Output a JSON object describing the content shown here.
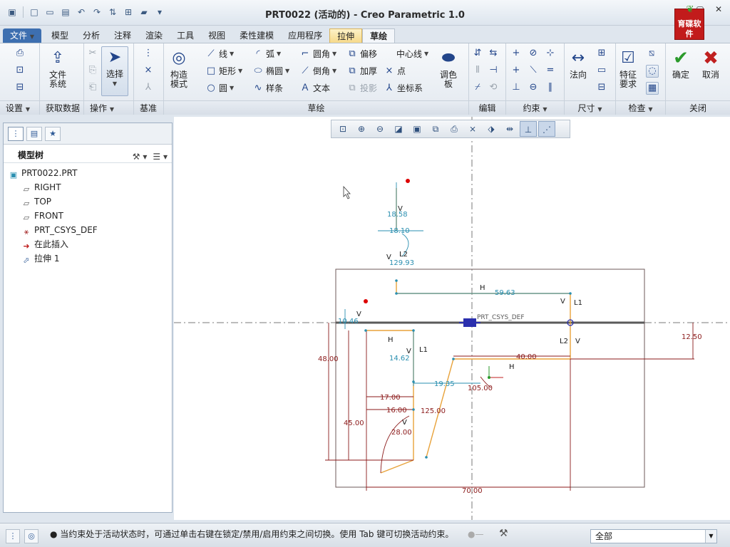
{
  "window": {
    "title": "PRT0022 (活动的) - Creo Parametric 1.0",
    "logo_text": "育碟软件"
  },
  "tabs": [
    {
      "label": "文件"
    },
    {
      "label": "模型"
    },
    {
      "label": "分析"
    },
    {
      "label": "注释"
    },
    {
      "label": "渲染"
    },
    {
      "label": "工具"
    },
    {
      "label": "视图"
    },
    {
      "label": "柔性建模"
    },
    {
      "label": "应用程序"
    },
    {
      "label": "拉伸"
    },
    {
      "label": "草绘"
    }
  ],
  "ribbon": {
    "groups": {
      "settings": "设置",
      "get_data": "获取数据",
      "operations": "操作",
      "datum": "基准",
      "sketch": "草绘",
      "edit": "编辑",
      "constrain": "约束",
      "dimension": "尺寸",
      "inspect": "检查",
      "close": "关闭"
    },
    "buttons": {
      "file_system_l1": "文件",
      "file_system_l2": "系统",
      "select": "选择",
      "construction_l1": "构造",
      "construction_l2": "模式",
      "line": "线",
      "rectangle": "矩形",
      "circle": "圆",
      "arc": "弧",
      "ellipse": "椭圆",
      "spline": "样条",
      "fillet": "圆角",
      "chamfer": "倒角",
      "text": "文本",
      "offset": "偏移",
      "thicken": "加厚",
      "project": "投影",
      "centerline": "中心线",
      "point": "点",
      "csys": "坐标系",
      "palette_l1": "调色",
      "palette_l2": "板",
      "normal": "法向",
      "feature_req_l1": "特征",
      "feature_req_l2": "要求",
      "ok": "确定",
      "cancel": "取消"
    }
  },
  "model_tree": {
    "title": "模型树",
    "items": [
      {
        "label": "PRT0022.PRT"
      },
      {
        "label": "RIGHT"
      },
      {
        "label": "TOP"
      },
      {
        "label": "FRONT"
      },
      {
        "label": "PRT_CSYS_DEF"
      },
      {
        "label": "在此插入"
      },
      {
        "label": "拉伸 1"
      }
    ]
  },
  "sketch": {
    "csys_label": "PRT_CSYS_DEF",
    "dims": {
      "d1858": "18.58",
      "d1810": "18.10",
      "d12993": "129.93",
      "d5963": "59.63",
      "d1046": "10.46",
      "d4800": "48.00",
      "d1462": "14.62",
      "d1250": "12.50",
      "d4000": "40.00",
      "d1935": "19.35",
      "d10500": "105.00",
      "d1700": "17.00",
      "d1600": "16.00",
      "d12500": "125.00",
      "d4500": "45.00",
      "d2800": "28.00",
      "d7000": "70.00"
    },
    "constraint_labels": {
      "V": "V",
      "H": "H",
      "L1": "L1",
      "L2": "L2"
    }
  },
  "status": {
    "message": "● 当约束处于活动状态时，可通过单击右键在锁定/禁用/启用约束之间切换。使用 Tab 键可切换活动约束。按住",
    "filter_value": "全部"
  },
  "colors": {
    "sketch_orange": "#e8a23a",
    "dim_red": "#8b1a1a",
    "dim_cyan": "#2a8fb0",
    "accent_blue": "#3d6fb0"
  }
}
